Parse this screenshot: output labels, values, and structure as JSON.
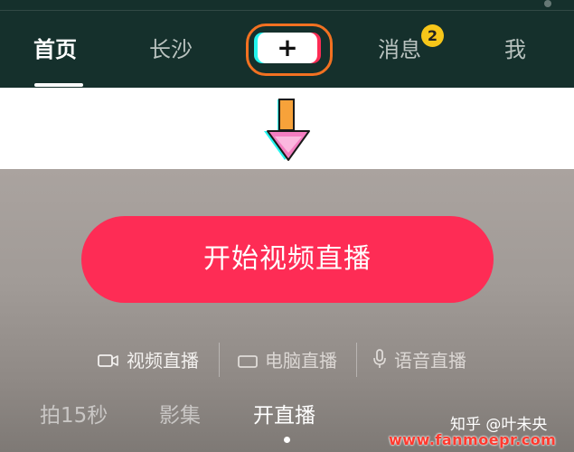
{
  "top_tabs": [
    {
      "label": "首页",
      "active": true
    },
    {
      "label": "长沙",
      "active": false
    },
    {
      "label": "消息",
      "active": false,
      "badge": "2"
    },
    {
      "label": "我",
      "active": false
    }
  ],
  "create_button": {
    "glyph": "+"
  },
  "highlight_color": "#f27121",
  "brand_colors": {
    "cyan": "#25f4ee",
    "red": "#fe2c55",
    "badge": "#f7c619"
  },
  "arrow_icon": "down-arrow-icon",
  "live": {
    "start_button_label": "开始视频直播",
    "modes": [
      {
        "label": "视频直播",
        "icon": "video-camera-icon",
        "active": true
      },
      {
        "label": "电脑直播",
        "icon": "monitor-icon",
        "active": false
      },
      {
        "label": "语音直播",
        "icon": "microphone-icon",
        "active": false
      }
    ],
    "bottom_tabs": [
      {
        "label": "拍15秒",
        "active": false
      },
      {
        "label": "影集",
        "active": false
      },
      {
        "label": "开直播",
        "active": true
      }
    ]
  },
  "credit": "知乎 @叶未央",
  "watermark": "www.fanmoepr.com"
}
